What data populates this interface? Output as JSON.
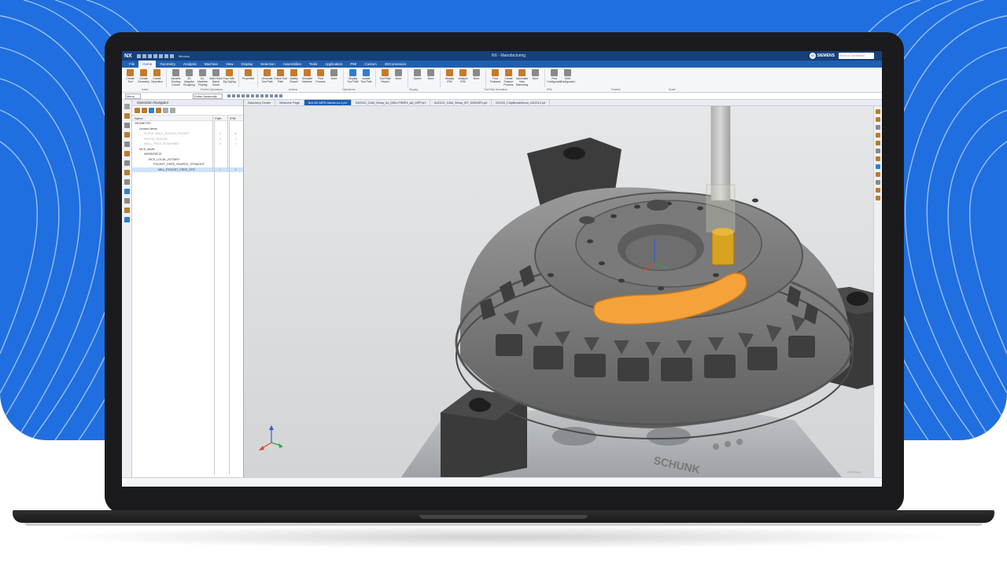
{
  "app": {
    "logo": "NX",
    "window_title": "NX - Manufacturing",
    "brand": "SIEMENS",
    "find_placeholder": "Find a Command",
    "avatar_initials": "SS",
    "window_menu": "Window"
  },
  "tabs": [
    "File",
    "Home",
    "Geometry",
    "Analysis",
    "Machine",
    "View",
    "Display",
    "Selection",
    "Assemblies",
    "Tools",
    "Application",
    "PMI",
    "Custom",
    "3DConnexion"
  ],
  "ribbon": {
    "buttons": [
      {
        "label": "Create Tool",
        "color": "#c57b2a"
      },
      {
        "label": "Create Geometry",
        "color": "#c57b2a"
      },
      {
        "label": "Create Operation",
        "color": "#c57b2a"
      },
      {
        "label": "Variable Guiding Curves",
        "color": "#8a8a8a"
      },
      {
        "label": "3D Adaptive Roughing",
        "color": "#8a8a8a"
      },
      {
        "label": "On-Machine Probing",
        "color": "#8a8a8a"
      },
      {
        "label": "Wall Finish Barrel Swarf",
        "color": "#8a8a8a"
      },
      {
        "label": "Face Mill - Zig ZigZag",
        "color": "#c57b2a"
      },
      {
        "label": "Properties",
        "color": "#c57b2a"
      },
      {
        "label": "Generate Tool Path",
        "color": "#c57b2a"
      },
      {
        "label": "Check Tool Path",
        "color": "#c57b2a"
      },
      {
        "label": "Validity Report",
        "color": "#c57b2a"
      },
      {
        "label": "Simulate Machine",
        "color": "#c57b2a"
      },
      {
        "label": "Post Process",
        "color": "#c57b2a"
      },
      {
        "label": "More",
        "color": "#8a8a8a"
      },
      {
        "label": "Display Tool Path",
        "color": "#2f7fd0"
      },
      {
        "label": "Isolate Tool Path",
        "color": "#2f7fd0"
      },
      {
        "label": "Tool Path Report",
        "color": "#c57b2a"
      },
      {
        "label": "More",
        "color": "#8a8a8a"
      },
      {
        "label": "Speed",
        "color": "#8a8a8a"
      },
      {
        "label": "More",
        "color": "#8a8a8a"
      },
      {
        "label": "Display IPW",
        "color": "#c57b2a"
      },
      {
        "label": "Analyze IPW",
        "color": "#c57b2a"
      },
      {
        "label": "More",
        "color": "#8a8a8a"
      },
      {
        "label": "Find Features",
        "color": "#c57b2a"
      },
      {
        "label": "Create Feature Process",
        "color": "#c57b2a"
      },
      {
        "label": "Automatic Hole Machining",
        "color": "#c57b2a"
      },
      {
        "label": "More",
        "color": "#8a8a8a"
      },
      {
        "label": "Post Configurator",
        "color": "#8a8a8a"
      },
      {
        "label": "OMA Configurator",
        "color": "#8a8a8a"
      }
    ],
    "groups": [
      "Insert",
      "Predict Operations",
      "Actions",
      "Operations",
      "Display",
      "Tool Path Animation",
      "IPW",
      "Feature",
      "Scale"
    ]
  },
  "cmdbar": {
    "menu": "Menu",
    "assembly_filter": "Entire Assembly"
  },
  "navigator": {
    "title": "Operation Navigator",
    "columns": [
      "Name",
      "Path",
      "IPW"
    ],
    "rows": [
      {
        "name": "GEOMETRY",
        "path": "",
        "ipw": "",
        "indent": 0,
        "dim": false,
        "selected": false
      },
      {
        "name": "Unused Items",
        "path": "",
        "ipw": "",
        "indent": 1,
        "dim": false,
        "selected": false
      },
      {
        "name": "FLOOR_WALL_ROUGH_POCKET",
        "path": "✓",
        "ipw": "✕",
        "indent": 2,
        "dim": true,
        "selected": false
      },
      {
        "name": "FACING_ROUGH",
        "path": "✓",
        "ipw": "○",
        "indent": 2,
        "dim": true,
        "selected": false
      },
      {
        "name": "WALL_TECH_ROUGHING",
        "path": "✓",
        "ipw": "○",
        "indent": 2,
        "dim": true,
        "selected": false
      },
      {
        "name": "MCS_MAIN",
        "path": "",
        "ipw": "",
        "indent": 1,
        "dim": false,
        "selected": false
      },
      {
        "name": "WORKPIECE",
        "path": "",
        "ipw": "",
        "indent": 2,
        "dim": false,
        "selected": false
      },
      {
        "name": "MCS_LOCAL_ROTARY",
        "path": "",
        "ipw": "",
        "indent": 3,
        "dim": false,
        "selected": false
      },
      {
        "name": "POCKET_FREE_SHAPED_STRAIGHT",
        "path": "",
        "ipw": "",
        "indent": 4,
        "dim": false,
        "selected": false
      },
      {
        "name": "MILL_POCKET_FREE_STR",
        "path": "✓",
        "ipw": "✕",
        "indent": 5,
        "dim": false,
        "selected": true
      }
    ]
  },
  "doc_tabs": [
    {
      "label": "Discovery Center",
      "active": false
    },
    {
      "label": "Welcome Page",
      "active": false
    },
    {
      "label": "5ch-NX-MRS-Hands-on-1.prt",
      "active": true
    },
    {
      "label": "NX2312_CAM_Setup_5x_DMU-FRBP4_sld_MPP.prt",
      "active": false
    },
    {
      "label": "NX2312_CAM_Setup_MT_DMG8FD.prt",
      "active": false
    },
    {
      "label": "NX100_ChipBreakDemo_NX2312.prt",
      "active": false
    }
  ],
  "viewport": {
    "fixture_brand": "SCHUNK",
    "watermark": "PRESLIN"
  }
}
